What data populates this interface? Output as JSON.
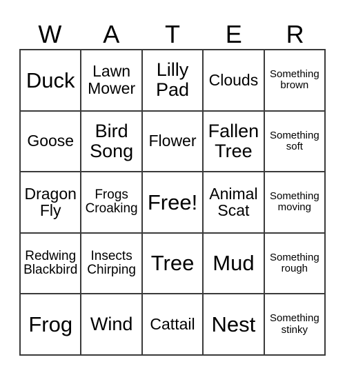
{
  "card": {
    "header": {
      "letters": [
        "W",
        "A",
        "T",
        "E",
        "R"
      ]
    },
    "rows": [
      {
        "cells": [
          {
            "text": "Duck",
            "size": "fs-xl"
          },
          {
            "text": "Lawn\nMower",
            "size": "fs-md"
          },
          {
            "text": "Lilly\nPad",
            "size": "fs-lg"
          },
          {
            "text": "Clouds",
            "size": "fs-md"
          },
          {
            "text": "Something\nbrown",
            "size": "fs-xs"
          }
        ]
      },
      {
        "cells": [
          {
            "text": "Goose",
            "size": "fs-md"
          },
          {
            "text": "Bird\nSong",
            "size": "fs-lg"
          },
          {
            "text": "Flower",
            "size": "fs-md"
          },
          {
            "text": "Fallen\nTree",
            "size": "fs-lg"
          },
          {
            "text": "Something\nsoft",
            "size": "fs-xs"
          }
        ]
      },
      {
        "cells": [
          {
            "text": "Dragon\nFly",
            "size": "fs-md"
          },
          {
            "text": "Frogs\nCroaking",
            "size": "fs-sm"
          },
          {
            "text": "Free!",
            "size": "fs-xl"
          },
          {
            "text": "Animal\nScat",
            "size": "fs-md"
          },
          {
            "text": "Something\nmoving",
            "size": "fs-xs"
          }
        ]
      },
      {
        "cells": [
          {
            "text": "Redwing\nBlackbird",
            "size": "fs-sm"
          },
          {
            "text": "Insects\nChirping",
            "size": "fs-sm"
          },
          {
            "text": "Tree",
            "size": "fs-xl"
          },
          {
            "text": "Mud",
            "size": "fs-xl"
          },
          {
            "text": "Something\nrough",
            "size": "fs-xs"
          }
        ]
      },
      {
        "cells": [
          {
            "text": "Frog",
            "size": "fs-xl"
          },
          {
            "text": "Wind",
            "size": "fs-lg"
          },
          {
            "text": "Cattail",
            "size": "fs-md"
          },
          {
            "text": "Nest",
            "size": "fs-xl"
          },
          {
            "text": "Something\nstinky",
            "size": "fs-xs"
          }
        ]
      }
    ],
    "colors": {
      "border": "#3a3a3a",
      "text": "#000000",
      "background": "#ffffff"
    }
  }
}
